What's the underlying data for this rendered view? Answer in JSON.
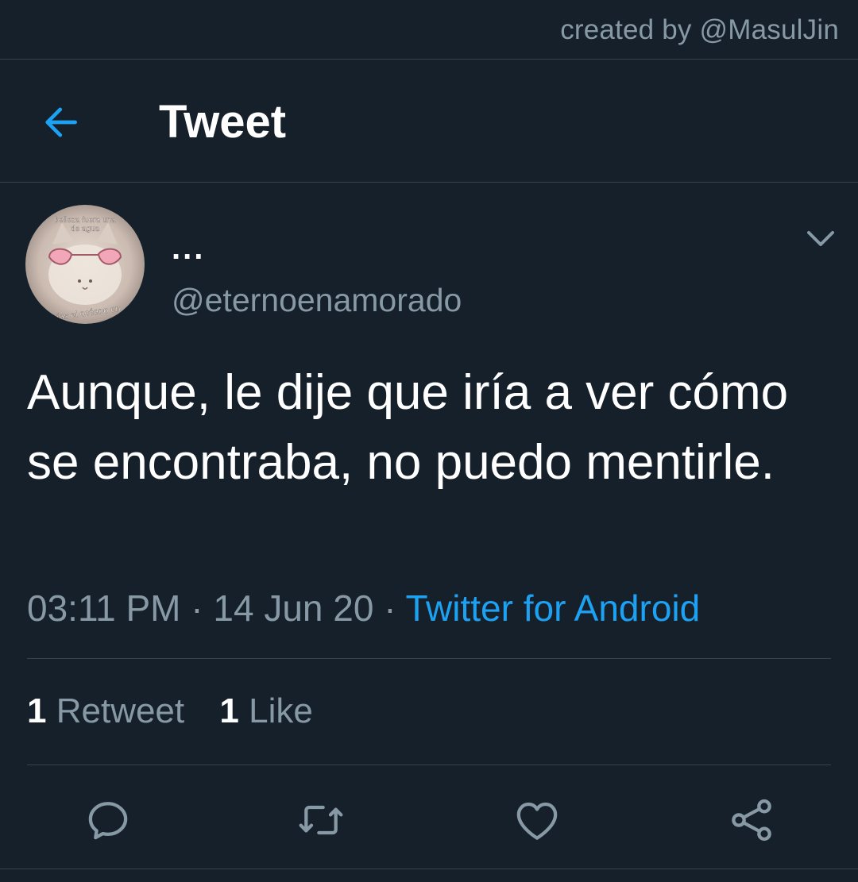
{
  "credit": "created by @MasulJin",
  "header": {
    "title": "Tweet",
    "back_icon": "arrow-left-icon"
  },
  "tweet": {
    "display_name": "...",
    "handle": "@eternoenamorado",
    "avatar": {
      "top_text": "belleza fuera una de agua",
      "bottom_text": "erías el océano en"
    },
    "text": "Aunque, le dije que iría a ver cómo se encontraba, no puedo mentirle.",
    "time": "03:11 PM",
    "separator": "·",
    "date": "14 Jun 20",
    "source": "Twitter for Android",
    "stats": {
      "retweets_count": "1",
      "retweets_label": "Retweet",
      "likes_count": "1",
      "likes_label": "Like"
    },
    "actions": [
      "reply-icon",
      "retweet-icon",
      "like-icon",
      "share-icon"
    ]
  },
  "colors": {
    "background": "#15202b",
    "accent": "#1da1f2",
    "secondary_text": "#8899a6",
    "divider": "#38444d"
  }
}
